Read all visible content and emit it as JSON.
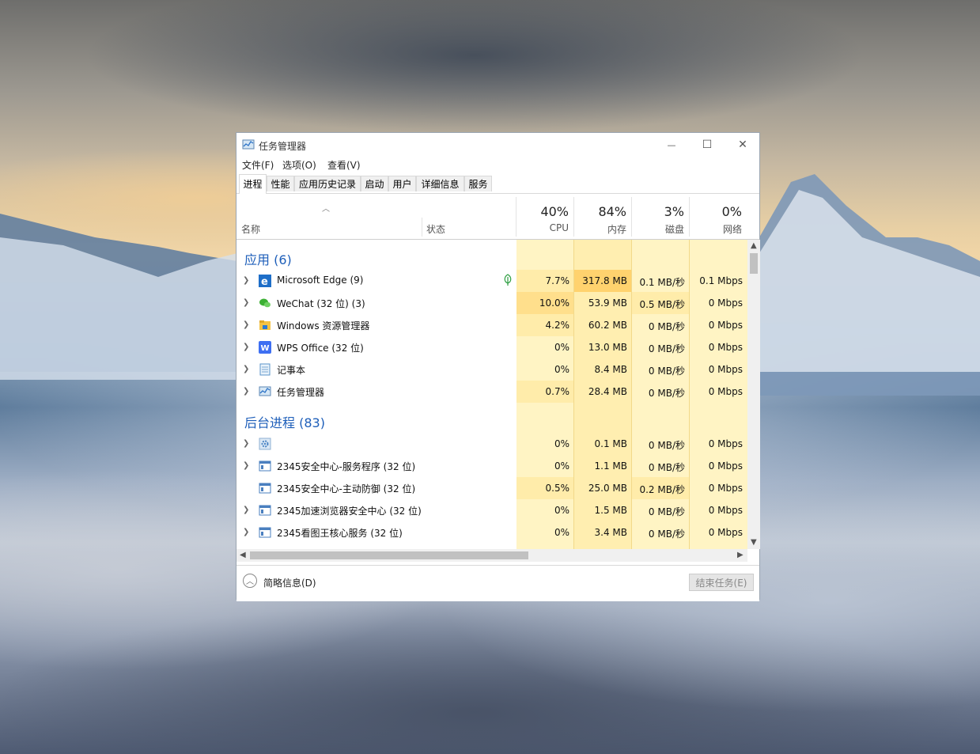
{
  "window": {
    "title": "任务管理器",
    "minimize_glyph": "—",
    "maximize_glyph": "☐",
    "close_glyph": "✕"
  },
  "menu": [
    "文件(F)",
    "选项(O)",
    "查看(V)"
  ],
  "tabs": [
    "进程",
    "性能",
    "应用历史记录",
    "启动",
    "用户",
    "详细信息",
    "服务"
  ],
  "active_tab": "进程",
  "columns": {
    "name": "名称",
    "status": "状态",
    "cpu": {
      "pct": "40%",
      "label": "CPU"
    },
    "memory": {
      "pct": "84%",
      "label": "内存"
    },
    "disk": {
      "pct": "3%",
      "label": "磁盘"
    },
    "network": {
      "pct": "0%",
      "label": "网络"
    }
  },
  "groups": {
    "apps": "应用 (6)",
    "background": "后台进程 (83)"
  },
  "apps": [
    {
      "name": "Microsoft Edge (9)",
      "icon": "edge-icon",
      "cpu": "7.7%",
      "mem": "317.8 MB",
      "disk": "0.1 MB/秒",
      "net": "0.1 Mbps",
      "efficiency_leaf": true
    },
    {
      "name": "WeChat (32 位) (3)",
      "icon": "wechat-icon",
      "cpu": "10.0%",
      "mem": "53.9 MB",
      "disk": "0.5 MB/秒",
      "net": "0 Mbps"
    },
    {
      "name": "Windows 资源管理器",
      "icon": "explorer-folder-icon",
      "cpu": "4.2%",
      "mem": "60.2 MB",
      "disk": "0 MB/秒",
      "net": "0 Mbps"
    },
    {
      "name": "WPS Office (32 位)",
      "icon": "wps-icon",
      "cpu": "0%",
      "mem": "13.0 MB",
      "disk": "0 MB/秒",
      "net": "0 Mbps"
    },
    {
      "name": "记事本",
      "icon": "notepad-icon",
      "cpu": "0%",
      "mem": "8.4 MB",
      "disk": "0 MB/秒",
      "net": "0 Mbps"
    },
    {
      "name": "任务管理器",
      "icon": "task-manager-icon",
      "cpu": "0.7%",
      "mem": "28.4 MB",
      "disk": "0 MB/秒",
      "net": "0 Mbps"
    }
  ],
  "background": [
    {
      "name": "",
      "icon": "gear-icon",
      "cpu": "0%",
      "mem": "0.1 MB",
      "disk": "0 MB/秒",
      "net": "0 Mbps",
      "expandable": true
    },
    {
      "name": "2345安全中心-服务程序 (32 位)",
      "icon": "service-window-icon",
      "cpu": "0%",
      "mem": "1.1 MB",
      "disk": "0 MB/秒",
      "net": "0 Mbps",
      "expandable": true
    },
    {
      "name": "2345安全中心-主动防御 (32 位)",
      "icon": "service-window-icon",
      "cpu": "0.5%",
      "mem": "25.0 MB",
      "disk": "0.2 MB/秒",
      "net": "0 Mbps",
      "expandable": false
    },
    {
      "name": "2345加速浏览器安全中心 (32 位)",
      "icon": "service-window-icon",
      "cpu": "0%",
      "mem": "1.5 MB",
      "disk": "0 MB/秒",
      "net": "0 Mbps",
      "expandable": true
    },
    {
      "name": "2345看图王核心服务 (32 位)",
      "icon": "service-window-icon",
      "cpu": "0%",
      "mem": "3.4 MB",
      "disk": "0 MB/秒",
      "net": "0 Mbps",
      "expandable": true
    }
  ],
  "footer": {
    "fewer_details": "简略信息(D)",
    "end_task": "结束任务(E)"
  },
  "colors": {
    "group_heading": "#1d5eb9",
    "cell_light": "#fff4c4",
    "cell_medium": "#ffe9a6",
    "cell_strong": "#ffd26e",
    "memory_column": "#ffeeb0"
  }
}
